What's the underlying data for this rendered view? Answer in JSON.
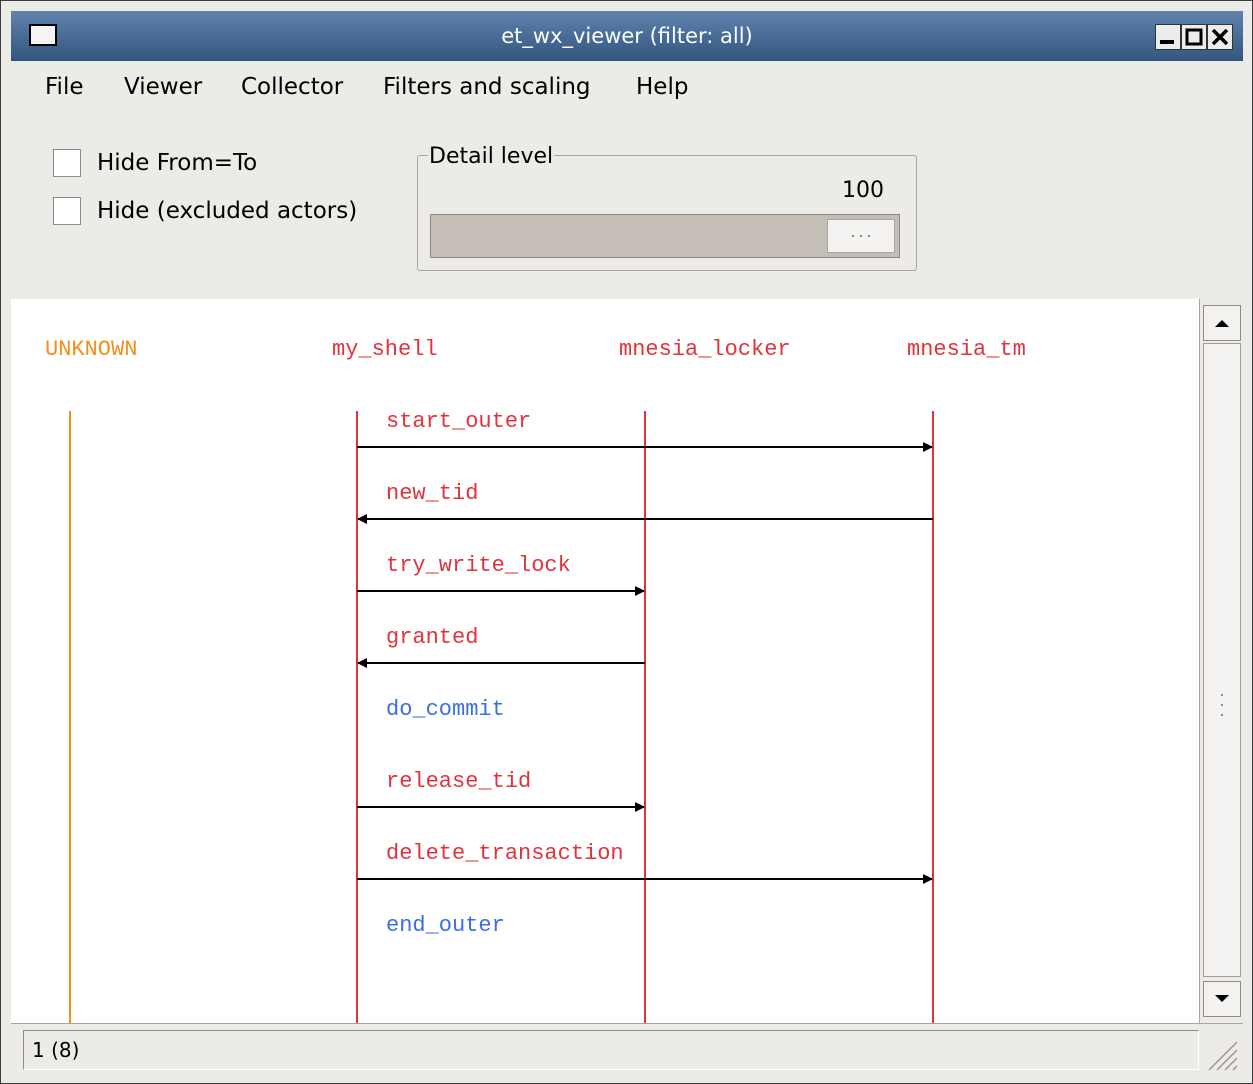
{
  "window": {
    "title": "et_wx_viewer (filter: all)"
  },
  "menubar": {
    "items": [
      "File",
      "Viewer",
      "Collector",
      "Filters and scaling",
      "Help"
    ]
  },
  "options": {
    "hide_from_to": {
      "label": "Hide From=To",
      "checked": false
    },
    "hide_excluded": {
      "label": "Hide (excluded actors)",
      "checked": false
    }
  },
  "detail": {
    "legend": "Detail level",
    "value": "100",
    "level_fraction": 1.0
  },
  "sequence": {
    "actors": [
      {
        "name": "UNKNOWN",
        "color": "#f0901e"
      },
      {
        "name": "my_shell",
        "color": "#e0343c"
      },
      {
        "name": "mnesia_locker",
        "color": "#e0343c"
      },
      {
        "name": "mnesia_tm",
        "color": "#e0343c"
      }
    ],
    "events": [
      {
        "label": "start_outer",
        "from": 1,
        "to": 3,
        "color": "#e0343c"
      },
      {
        "label": "new_tid",
        "from": 3,
        "to": 1,
        "color": "#e0343c"
      },
      {
        "label": "try_write_lock",
        "from": 1,
        "to": 2,
        "color": "#e0343c"
      },
      {
        "label": "granted",
        "from": 2,
        "to": 1,
        "color": "#e0343c"
      },
      {
        "label": "do_commit",
        "from": 1,
        "to": 1,
        "color": "#3b6fe0"
      },
      {
        "label": "release_tid",
        "from": 1,
        "to": 2,
        "color": "#e0343c"
      },
      {
        "label": "delete_transaction",
        "from": 1,
        "to": 3,
        "color": "#e0343c"
      },
      {
        "label": "end_outer",
        "from": 1,
        "to": 1,
        "color": "#3b6fe0"
      }
    ]
  },
  "status": {
    "text": "1 (8)"
  }
}
